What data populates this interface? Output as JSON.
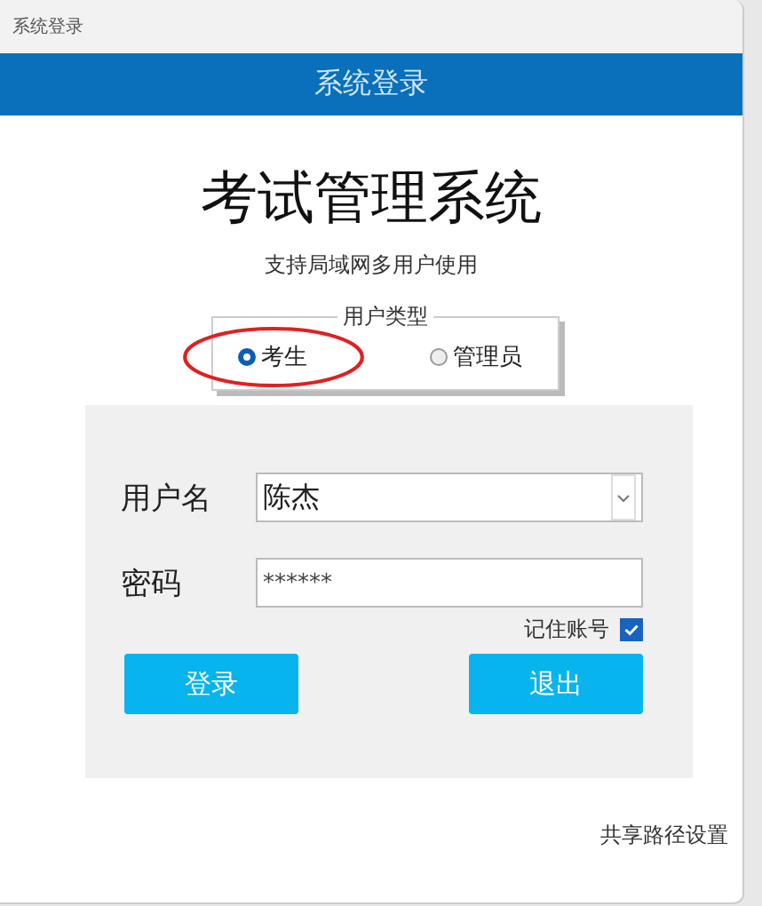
{
  "window": {
    "title": "系统登录"
  },
  "header": {
    "title": "系统登录"
  },
  "app_title": "考试管理系统",
  "subtitle": "支持局域网多用户使用",
  "user_type": {
    "legend": "用户类型",
    "options": [
      {
        "label": "考生",
        "selected": true
      },
      {
        "label": "管理员",
        "selected": false
      }
    ]
  },
  "form": {
    "username_label": "用户名",
    "username_value": "陈杰",
    "password_label": "密码",
    "password_value": "******",
    "remember": {
      "label": "记住账号",
      "checked": true
    }
  },
  "buttons": [
    {
      "label": "登录"
    },
    {
      "label": "退出"
    }
  ],
  "footer_link": "共享路径设置"
}
